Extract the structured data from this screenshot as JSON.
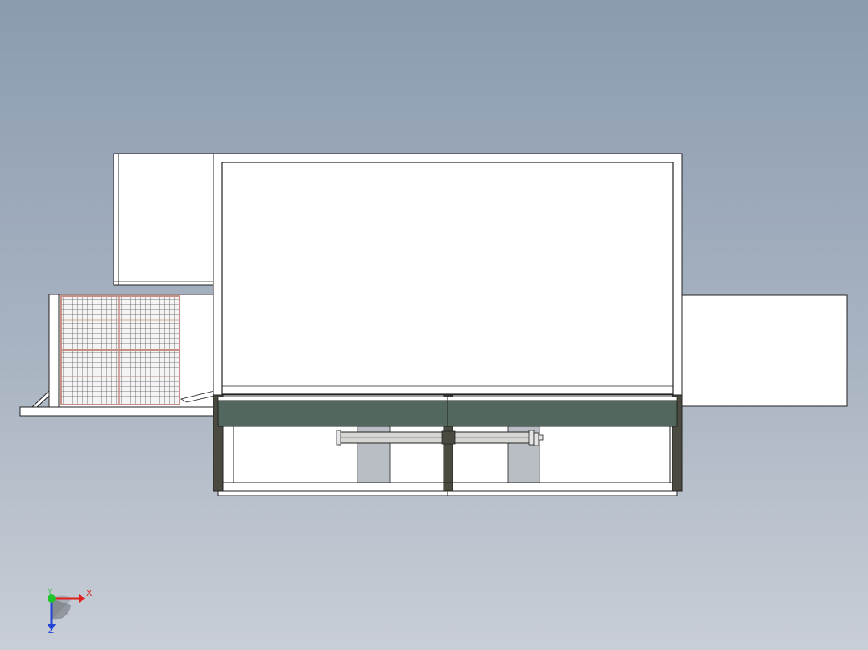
{
  "app": {
    "view": "3d-model-viewport",
    "background_top": "#8b9bb0",
    "background_bottom": "#c9ced6"
  },
  "model": {
    "panel_color": "#52685f",
    "frame_color": "#4a4a40",
    "grille_color": "#c98f86",
    "outline_color": "#222222"
  },
  "triad": {
    "x_label": "X",
    "y_label": "Y",
    "z_label": "Z",
    "x_color": "#e0201c",
    "y_color": "#21c42b",
    "z_color": "#2043d8"
  }
}
